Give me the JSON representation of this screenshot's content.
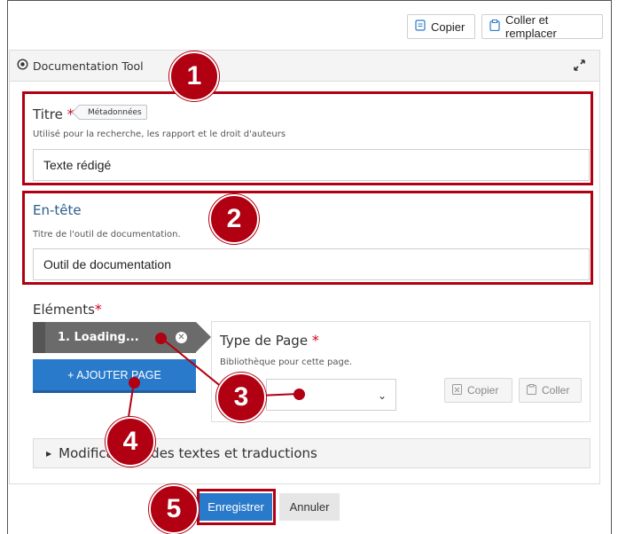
{
  "toolbar": {
    "copy_label": "Copier",
    "paste_replace_label": "Coller et remplacer"
  },
  "panel": {
    "title": "Documentation Tool"
  },
  "fields": {
    "titre": {
      "label": "Titre",
      "required_mark": "*",
      "tag": "Métadonnées",
      "help": "Utilisé pour la recherche, les rapport et le droit d'auteurs",
      "value": "Texte rédigé"
    },
    "entete": {
      "label": "En-tête",
      "help": "Titre de l'outil de documentation.",
      "value": "Outil de documentation"
    }
  },
  "elements": {
    "label": "Eléments",
    "required_mark": "*",
    "page_tab": "1. Loading...",
    "add_page_label": "+ AJOUTER PAGE",
    "page_type": {
      "label": "Type de Page",
      "required_mark": "*",
      "help": "Bibliothèque pour cette page.",
      "copy_label": "Copier",
      "paste_label": "Coller"
    }
  },
  "accordion": {
    "label": "Modifications des textes et traductions"
  },
  "actions": {
    "save_label": "Enregistrer",
    "cancel_label": "Annuler"
  },
  "callouts": [
    "1",
    "2",
    "3",
    "4",
    "5"
  ],
  "colors": {
    "callout_red": "#b00012",
    "primary_blue": "#2a7acb"
  }
}
